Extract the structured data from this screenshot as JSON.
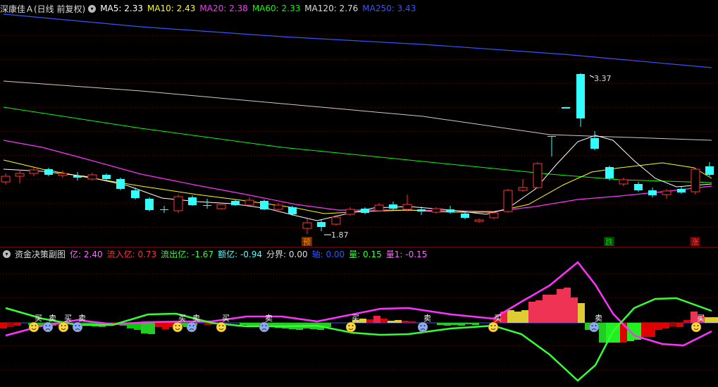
{
  "main": {
    "title": "深康佳Ａ(日线 前复权)",
    "ma": [
      {
        "label": "MA5: 2.33",
        "color": "#ffffff"
      },
      {
        "label": "MA10: 2.43",
        "color": "#ffff00"
      },
      {
        "label": "MA20: 2.38",
        "color": "#ff33ff"
      },
      {
        "label": "MA60: 2.33",
        "color": "#00ff00"
      },
      {
        "label": "MA120: 2.76",
        "color": "#dddddd"
      },
      {
        "label": "MA250: 3.43",
        "color": "#3355ff"
      }
    ],
    "high_label": "3.37",
    "low_label": "1.87",
    "signals": [
      {
        "text": "预",
        "color": "#ff8800"
      },
      {
        "text": "跌",
        "color": "#00cc00"
      },
      {
        "text": "涨",
        "color": "#ff3333"
      }
    ]
  },
  "sub": {
    "title": "资金决策副图",
    "items": [
      {
        "label": "亿: 2.40",
        "color": "#ff66ff"
      },
      {
        "label": "流入亿: 0.73",
        "color": "#ff3333"
      },
      {
        "label": "流出亿: -1.67",
        "color": "#33ff33"
      },
      {
        "label": "额亿: -0.94",
        "color": "#55ffff"
      },
      {
        "label": "分界: 0.00",
        "color": "#dddddd"
      },
      {
        "label": "轴: 0.00",
        "color": "#3355ff"
      },
      {
        "label": "量: 0.15",
        "color": "#33ff33"
      },
      {
        "label": "量1: -0.15",
        "color": "#ff66ff"
      }
    ],
    "buy_label": "买",
    "sell_label": "卖"
  },
  "colors": {
    "up": "#ff3333",
    "down": "#33ffff",
    "grid": "#7a0000"
  }
}
